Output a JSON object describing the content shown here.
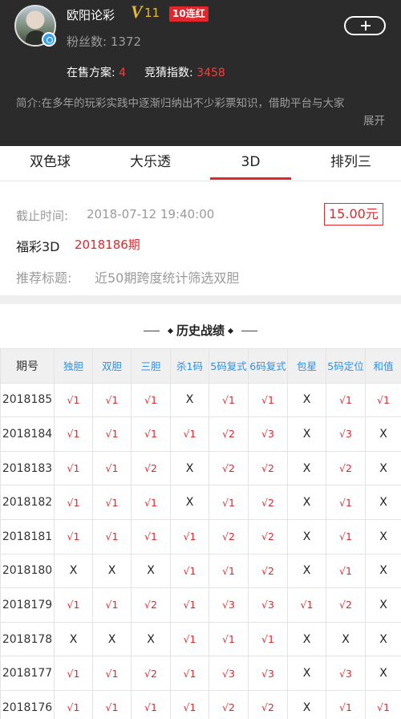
{
  "profile": {
    "name": "欧阳论彩",
    "vip_letter": "V",
    "vip_level": "11",
    "streak_badge": "10连红",
    "fans": "粉丝数: 1372",
    "on_sale_label": "在售方案: ",
    "on_sale_value": "4",
    "guess_label": "竞猜指数: ",
    "guess_value": "3458",
    "intro_text": "简介:在多年的玩彩实践中逐渐归纳出不少彩票知识，借助平台与大家",
    "intro_more": "展开"
  },
  "tabs": [
    "双色球",
    "大乐透",
    "3D",
    "排列三"
  ],
  "active_tab": "3D",
  "plan": {
    "deadline_label": "截止时间:",
    "deadline_value": "2018-07-12 19:40:00",
    "price": "15.00元",
    "lottery_name": "福彩3D",
    "issue": "2018186期",
    "title_label": "推荐标题:",
    "title_value": "近50期跨度统计筛选双胆"
  },
  "history": {
    "title": "历史战绩",
    "columns": [
      "期号",
      "独胆",
      "双胆",
      "三胆",
      "杀1码",
      "5码复式",
      "6码复式",
      "包星",
      "5码定位",
      "和值"
    ],
    "rows": [
      [
        "2018185",
        "√1",
        "√1",
        "√1",
        "X",
        "√1",
        "√1",
        "X",
        "√1",
        "√1"
      ],
      [
        "2018184",
        "√1",
        "√1",
        "√1",
        "√1",
        "√2",
        "√3",
        "X",
        "√3",
        "X"
      ],
      [
        "2018183",
        "√1",
        "√1",
        "√2",
        "X",
        "√2",
        "√2",
        "X",
        "√2",
        "X"
      ],
      [
        "2018182",
        "√1",
        "√1",
        "√1",
        "X",
        "√1",
        "√2",
        "X",
        "√1",
        "X"
      ],
      [
        "2018181",
        "√1",
        "√1",
        "√1",
        "√1",
        "√2",
        "√2",
        "X",
        "√1",
        "X"
      ],
      [
        "2018180",
        "X",
        "X",
        "X",
        "√1",
        "√1",
        "√2",
        "X",
        "√1",
        "X"
      ],
      [
        "2018179",
        "√1",
        "√1",
        "√2",
        "√1",
        "√3",
        "√3",
        "√1",
        "√2",
        "X"
      ],
      [
        "2018178",
        "X",
        "X",
        "X",
        "√1",
        "√1",
        "√1",
        "X",
        "X",
        "X"
      ],
      [
        "2018177",
        "√1",
        "√1",
        "√2",
        "√1",
        "√3",
        "√3",
        "X",
        "√3",
        "X"
      ],
      [
        "2018176",
        "√1",
        "√1",
        "√1",
        "√1",
        "√2",
        "√2",
        "X",
        "√1",
        "√1"
      ]
    ]
  },
  "colors": {
    "header_bg": "#2b2b2b",
    "accent_red": "#e2262b",
    "vip_gold": "#e8b83a",
    "column_blue": "#2f8fe6"
  }
}
